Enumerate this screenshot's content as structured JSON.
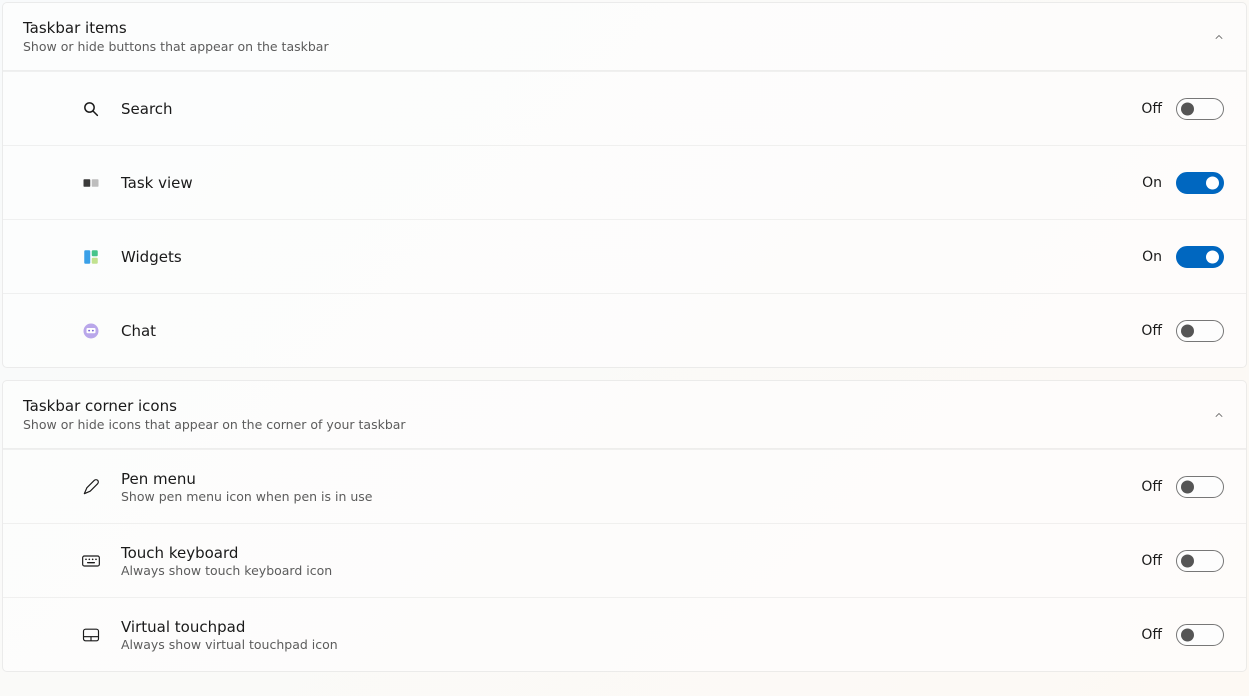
{
  "sections": [
    {
      "id": "taskbar-items",
      "title": "Taskbar items",
      "subtitle": "Show or hide buttons that appear on the taskbar",
      "expanded": true,
      "items": [
        {
          "id": "search",
          "icon": "search-icon",
          "label": "Search",
          "sub": "",
          "state": "Off",
          "on": false
        },
        {
          "id": "taskview",
          "icon": "taskview-icon",
          "label": "Task view",
          "sub": "",
          "state": "On",
          "on": true
        },
        {
          "id": "widgets",
          "icon": "widgets-icon",
          "label": "Widgets",
          "sub": "",
          "state": "On",
          "on": true
        },
        {
          "id": "chat",
          "icon": "chat-icon",
          "label": "Chat",
          "sub": "",
          "state": "Off",
          "on": false
        }
      ]
    },
    {
      "id": "taskbar-corner-icons",
      "title": "Taskbar corner icons",
      "subtitle": "Show or hide icons that appear on the corner of your taskbar",
      "expanded": true,
      "items": [
        {
          "id": "pen-menu",
          "icon": "pen-icon",
          "label": "Pen menu",
          "sub": "Show pen menu icon when pen is in use",
          "state": "Off",
          "on": false
        },
        {
          "id": "touch-keyboard",
          "icon": "keyboard-icon",
          "label": "Touch keyboard",
          "sub": "Always show touch keyboard icon",
          "state": "Off",
          "on": false
        },
        {
          "id": "virtual-touchpad",
          "icon": "touchpad-icon",
          "label": "Virtual touchpad",
          "sub": "Always show virtual touchpad icon",
          "state": "Off",
          "on": false
        }
      ]
    }
  ]
}
